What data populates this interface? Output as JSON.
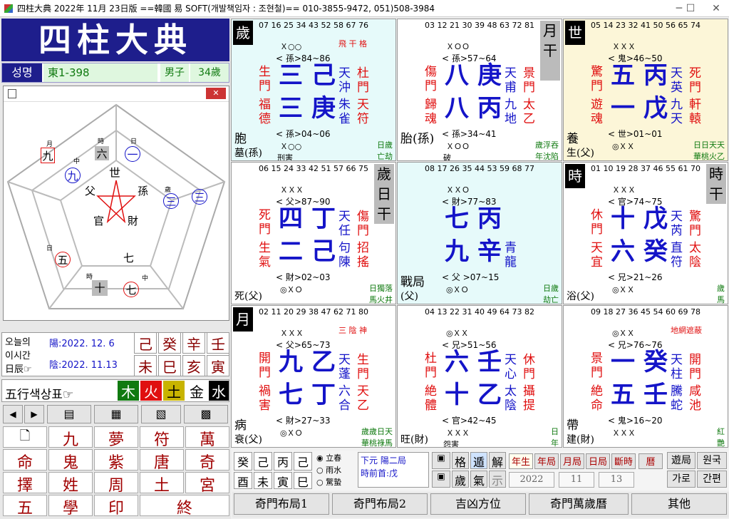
{
  "window": {
    "title": "四柱大典 2022年 11月 23日版 ==韓國 易 SOFT(개발책임자 : 조현철)== 010-3855-9472, 051)508-3984",
    "min": "─",
    "max": "☐",
    "close": "✕"
  },
  "logo": "四柱大典",
  "person": {
    "label": "성명",
    "name": "東1-398",
    "gender": "男子",
    "age": "34歲"
  },
  "wheel": {
    "center": "世",
    "items": [
      "父",
      "孫",
      "官",
      "財"
    ],
    "outer": [
      "六",
      "一",
      "九",
      "三",
      "三",
      "五",
      "七",
      "七",
      "十",
      "九"
    ],
    "small": [
      "月",
      "時",
      "日",
      "中",
      "歲",
      "日",
      "時",
      "中"
    ]
  },
  "dates": {
    "label1": "오늘의",
    "label2": "이시간",
    "label3": "日辰☞",
    "solar": "陽:2022. 12. 6",
    "lunar": "陰:2022. 11.13",
    "gz_top": [
      "己",
      "癸",
      "辛",
      "壬"
    ],
    "gz_bot": [
      "未",
      "巳",
      "亥",
      "寅"
    ]
  },
  "legend": {
    "label": "五行색상표☞",
    "items": [
      "木",
      "火",
      "土",
      "金",
      "水"
    ],
    "colors": [
      "#107a10",
      "#e01010",
      "#c8b400",
      "#222",
      "#000"
    ]
  },
  "grid": [
    "九",
    "夢",
    "符",
    "萬",
    "命",
    "鬼",
    "紫",
    "唐",
    "奇",
    "擇",
    "姓",
    "周",
    "土",
    "宮",
    "五",
    "學",
    "印",
    "終"
  ],
  "cells": [
    {
      "nums": "07 16 25 34 43 52 58 67 76",
      "note": "飛 干 格",
      "tag": "歲",
      "top": "Ｘ○○",
      "kin1": "< 孫>84~86",
      "l1": "生",
      "l2": "門",
      "c1": "三",
      "c2": "己",
      "r1": "天沖",
      "r2": "杜門",
      "l3": "福",
      "l4": "德",
      "c3": "三",
      "c4": "庚",
      "r3": "朱雀",
      "r4": "天符",
      "kin2": "< 孫>04~06",
      "bot": "Ｘ○○",
      "a": "胞",
      "b": "墓(孫)",
      "c": "刑害",
      "d": "日歲",
      "e": "亡劫"
    },
    {
      "nums": "03 12 21 30 39 48 63 72 81",
      "tag": "月干",
      "top": "ＸＯＯ",
      "kin1": "< 孫>57~64",
      "l1": "傷",
      "l2": "門",
      "c1": "八",
      "c2": "庚",
      "r1": "天甫",
      "r2": "景門",
      "l3": "歸",
      "l4": "魂",
      "c3": "八",
      "c4": "丙",
      "r3": "九地",
      "r4": "太乙",
      "kin2": "< 孫>34~41",
      "bot": "ＸＯＯ",
      "a": "胎(孫)",
      "c": "破",
      "d": "歲浮吞",
      "e": "年沈陷"
    },
    {
      "nums": "05 14 23 32 41 50 56 65 74",
      "tag": "世",
      "top": "ＸＸＸ",
      "kin1": "< 鬼>46~50",
      "l1": "驚",
      "l2": "門",
      "c1": "五",
      "c2": "丙",
      "r1": "天英",
      "r2": "死門",
      "l3": "遊",
      "l4": "魂",
      "c3": "一",
      "c4": "戊",
      "r3": "九天",
      "r4": "軒轅",
      "kin2": "< 世>01~01",
      "bot": "◎ＸＸ",
      "a": "養",
      "b": "生(父)",
      "d": "日日天天",
      "e": "華桃火乙"
    },
    {
      "nums": "06 15 24 33 42 51 57 66 75",
      "tag": "歲日干",
      "top": "ＸＸＸ",
      "kin1": "< 父>87~90",
      "l1": "死",
      "l2": "門",
      "c1": "四",
      "c2": "丁",
      "r1": "天任",
      "r2": "傷門",
      "l3": "生",
      "l4": "氣",
      "c3": "二",
      "c4": "己",
      "r3": "句陳",
      "r4": "招搖",
      "kin2": "< 財>02~03",
      "bot": "◎ＸＯ",
      "b": "死(父)",
      "d": "日獨落",
      "e": "馬火井"
    },
    {
      "nums": "08 17 26 35 44 53 59 68 77",
      "top": "ＸＸＯ",
      "kin1": "< 財>77~83",
      "c1": "七",
      "c2": "丙",
      "c3": "九",
      "c4": "辛",
      "r3": "青龍",
      "a": "戰局",
      "kin2": "< 父 >07~15",
      "bot": "◎ＸＯ",
      "b": "(父)",
      "d": "日歲",
      "e": "劫亡"
    },
    {
      "nums": "01 10 19 28 37 46 55 61 70",
      "tag": "時",
      "tag2": "時干",
      "top": "ＸＸＸ",
      "kin1": "< 官>74~75",
      "l1": "休",
      "l2": "門",
      "c1": "十",
      "c2": "戊",
      "r1": "天芮",
      "r2": "驚門",
      "l3": "天",
      "l4": "宜",
      "c3": "六",
      "c4": "癸",
      "r3": "直符",
      "r4": "太陰",
      "kin2": "< 兄>21~26",
      "bot": "◎ＸＸ",
      "b": "浴(父)",
      "d": "歲",
      "e": "馬"
    },
    {
      "nums": "02 11 20 29 38 47 62 71 80",
      "note": "三 陰 神",
      "tag": "月",
      "top": "ＸＸＸ",
      "kin1": "< 父>65~73",
      "l1": "開",
      "l2": "門",
      "c1": "九",
      "c2": "乙",
      "r1": "天蓬",
      "r2": "生門",
      "l3": "禍",
      "l4": "害",
      "c3": "七",
      "c4": "丁",
      "r3": "六合",
      "r4": "天乙",
      "kin2": "< 財>27~33",
      "bot": "◎ＸＯ",
      "a": "病",
      "b": "衰(父)",
      "d": "歲歲日天",
      "e": "華桃祿馬"
    },
    {
      "nums": "04 13 22 31 40 49 64 73 82",
      "top": "◎ＸＸ",
      "kin1": "< 兄>51~56",
      "l1": "杜",
      "l2": "門",
      "c1": "六",
      "c2": "壬",
      "r1": "天心",
      "r2": "休門",
      "l3": "絶",
      "l4": "體",
      "c3": "十",
      "c4": "乙",
      "r3": "太陰",
      "r4": "攝提",
      "kin2": "< 官>42~45",
      "bot": "ＸＸＸ",
      "b": "旺(財)",
      "c": "怨害",
      "d": "日",
      "e": "年"
    },
    {
      "nums": "09 18 27 36 45 54 60 69 78",
      "note": "地網遮蔽",
      "top": "◎ＸＸ",
      "kin1": "< 兄>76~76",
      "l1": "景",
      "l2": "門",
      "c1": "一",
      "c2": "癸",
      "r1": "天柱",
      "r2": "開門",
      "l3": "絶",
      "l4": "命",
      "c3": "五",
      "c4": "壬",
      "r3": "騰蛇",
      "r4": "咸池",
      "kin2": "< 鬼>16~20",
      "bot": "ＸＸＸ",
      "a": "帶",
      "b": "建(財)",
      "d": "紅",
      "e": "艷"
    }
  ],
  "bottom": {
    "gz1": [
      "癸",
      "己",
      "丙",
      "己"
    ],
    "gz2": [
      "酉",
      "未",
      "寅",
      "巳"
    ],
    "radio": [
      "立春",
      "雨水",
      "驚蟄"
    ],
    "info1": "下元 陽二局",
    "info2": "時前首:戊",
    "g1": [
      "格",
      "遁",
      "解"
    ],
    "g2": [
      "歲",
      "氣",
      "示"
    ],
    "tabs": [
      "年生",
      "年局",
      "月局",
      "日局",
      "斷時",
      "曆"
    ],
    "year": "2022",
    "month": "11",
    "day": "13",
    "k1": "遊局",
    "k2": "원국",
    "k3": "가로",
    "k4": "간편"
  },
  "footer": [
    "奇門布局1",
    "奇門布局2",
    "吉凶方位",
    "奇門萬歲曆",
    "其他"
  ]
}
